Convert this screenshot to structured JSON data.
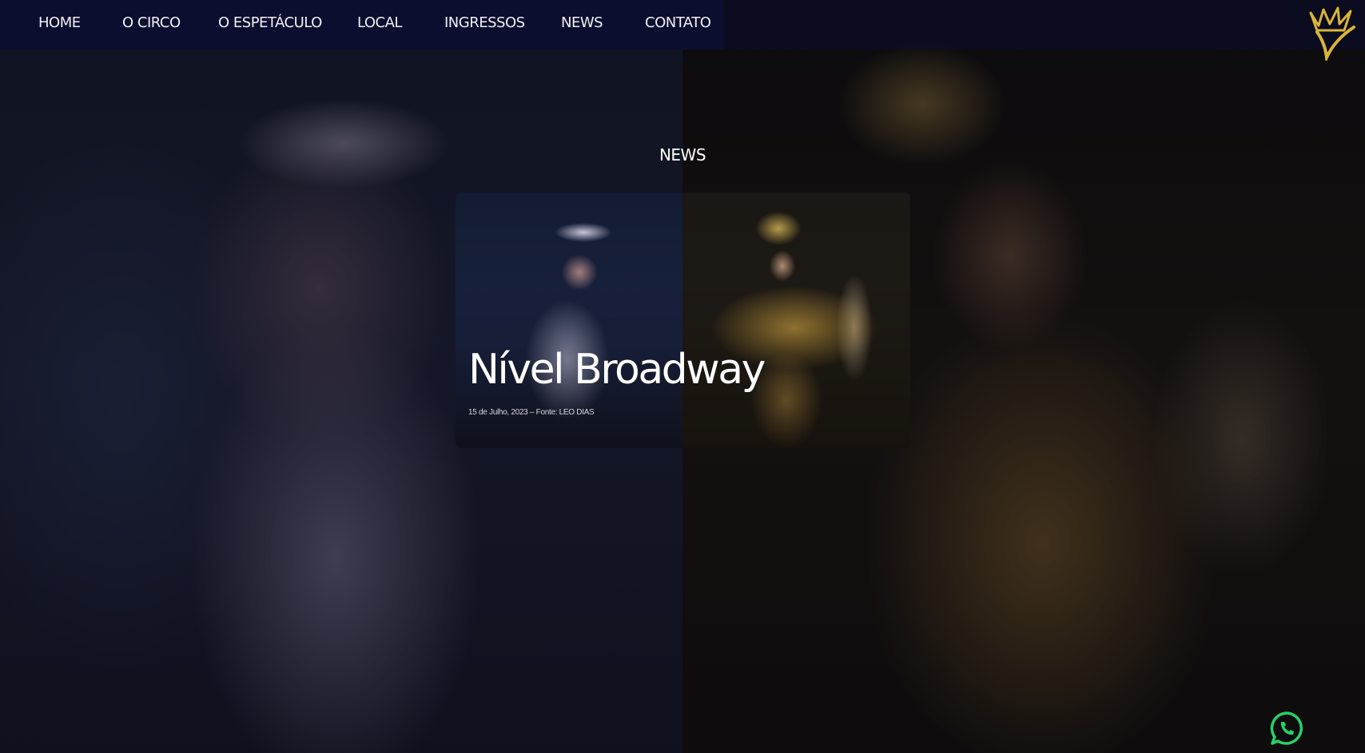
{
  "nav": {
    "items": [
      {
        "label": "HOME"
      },
      {
        "label": "O CIRCO"
      },
      {
        "label": "O ESPETÁCULO"
      },
      {
        "label": "LOCAL"
      },
      {
        "label": "INGRESSOS"
      },
      {
        "label": "NEWS"
      },
      {
        "label": "CONTATO"
      }
    ],
    "logo_icon": "crown-logo-icon"
  },
  "section": {
    "title": "NEWS"
  },
  "news_card": {
    "title": "Nível Broadway",
    "meta": "15 de Julho, 2023 – Fonte: LEO DIAS"
  },
  "floating": {
    "whatsapp_icon": "whatsapp-icon"
  },
  "colors": {
    "nav_bg": "#0b0e2f",
    "accent_gold": "#d9b53a",
    "whatsapp_green": "#25d366"
  }
}
